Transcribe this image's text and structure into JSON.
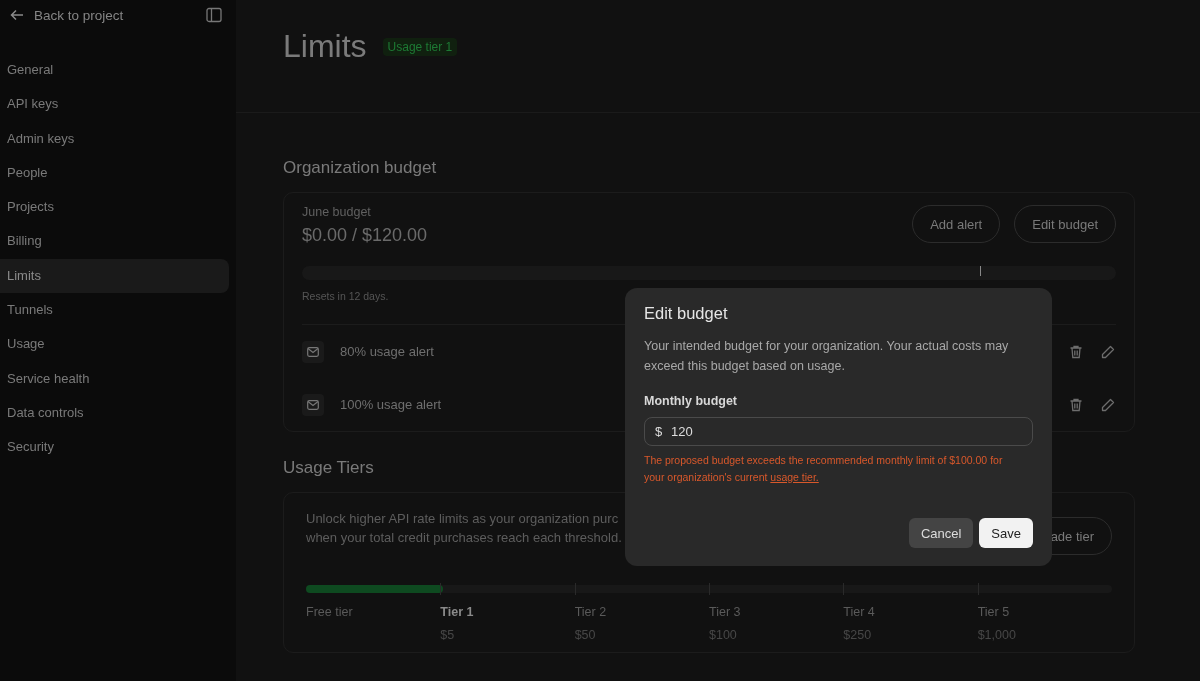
{
  "sidebar": {
    "back_label": "Back to project",
    "items": [
      {
        "label": "General",
        "selected": false
      },
      {
        "label": "API keys",
        "selected": false
      },
      {
        "label": "Admin keys",
        "selected": false
      },
      {
        "label": "People",
        "selected": false
      },
      {
        "label": "Projects",
        "selected": false
      },
      {
        "label": "Billing",
        "selected": false
      },
      {
        "label": "Limits",
        "selected": true
      },
      {
        "label": "Tunnels",
        "selected": false
      },
      {
        "label": "Usage",
        "selected": false
      },
      {
        "label": "Service health",
        "selected": false
      },
      {
        "label": "Data controls",
        "selected": false
      },
      {
        "label": "Security",
        "selected": false
      }
    ]
  },
  "header": {
    "title": "Limits",
    "badge": "Usage tier 1"
  },
  "budget": {
    "section_title": "Organization budget",
    "label": "June budget",
    "amount": "$0.00 / $120.00",
    "buttons": [
      "Add alert",
      "Edit budget"
    ],
    "limit_marker": {
      "level": 0.833
    },
    "reset_note": "Resets in 12 days.",
    "alerts": [
      {
        "label": "80% usage alert"
      },
      {
        "label": "100% usage alert"
      }
    ]
  },
  "usage_tiers": {
    "section_title": "Usage Tiers",
    "description_lines": [
      "Unlock higher API rate limits as your organization purc",
      "when your total credit purchases reach each threshold."
    ],
    "button": "ade tier",
    "level": 0.17,
    "tiers": [
      {
        "name": "Free tier",
        "selected": false
      },
      {
        "name": "Tier 1",
        "price": "$5",
        "selected": true
      },
      {
        "name": "Tier 2",
        "price": "$50",
        "selected": false
      },
      {
        "name": "Tier 3",
        "price": "$100",
        "selected": false
      },
      {
        "name": "Tier 4",
        "price": "$250",
        "selected": false
      },
      {
        "name": "Tier 5",
        "price": "$1,000",
        "selected": false
      }
    ]
  },
  "dialog": {
    "title": "Edit budget",
    "description": "Your intended budget for your organization. Your actual costs may exceed this budget based on usage.",
    "field_label": "Monthly budget",
    "currency": "$",
    "value": "120",
    "error": "The proposed budget exceeds the recommended monthly limit of $100.00 for your organization's current",
    "error_link": "usage tier.",
    "buttons": [
      "Cancel",
      "Save"
    ]
  }
}
